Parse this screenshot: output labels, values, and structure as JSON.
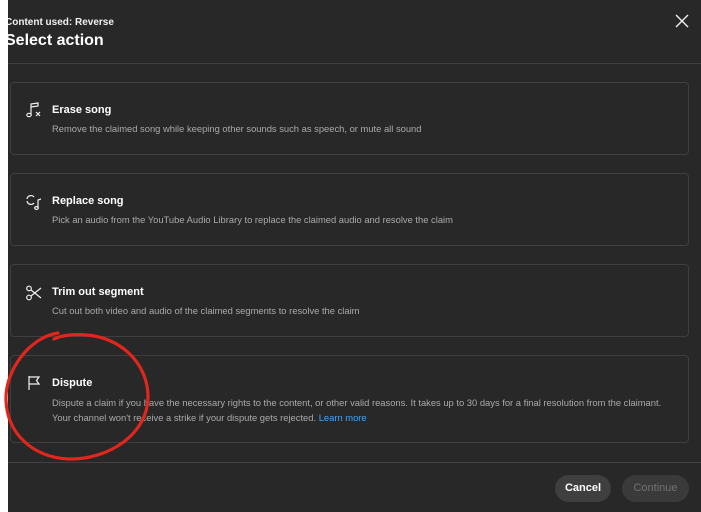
{
  "header": {
    "content_used": "Content used: Reverse",
    "title": "Select action"
  },
  "options": [
    {
      "icon": "music-note-icon",
      "title": "Erase song",
      "description": "Remove the claimed song while keeping other sounds such as speech, or mute all sound"
    },
    {
      "icon": "swap-audio-icon",
      "title": "Replace song",
      "description": "Pick an audio from the YouTube Audio Library to replace the claimed audio and resolve the claim"
    },
    {
      "icon": "scissors-icon",
      "title": "Trim out segment",
      "description": "Cut out both video and audio of the claimed segments to resolve the claim"
    },
    {
      "icon": "flag-icon",
      "title": "Dispute",
      "description": "Dispute a claim if you have the necessary rights to the content, or other valid reasons. It takes up to 30 days for a final resolution from the claimant. Your channel won't receive a strike if your dispute gets rejected.",
      "link": "Learn more"
    }
  ],
  "footer": {
    "cancel_label": "Cancel",
    "continue_label": "Continue"
  },
  "colors": {
    "dialog_bg": "#282828",
    "border": "#3f3f3f",
    "link": "#3ea6ff",
    "annotation": "#e0261d"
  }
}
